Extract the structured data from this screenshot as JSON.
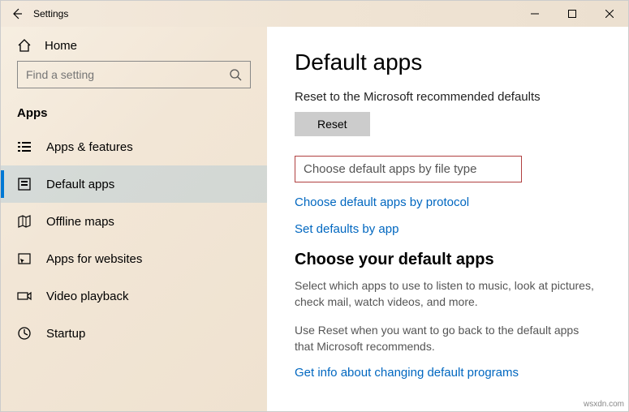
{
  "titlebar": {
    "appname": "Settings"
  },
  "sidebar": {
    "home": "Home",
    "search_placeholder": "Find a setting",
    "category": "Apps",
    "items": [
      {
        "label": "Apps & features"
      },
      {
        "label": "Default apps"
      },
      {
        "label": "Offline maps"
      },
      {
        "label": "Apps for websites"
      },
      {
        "label": "Video playback"
      },
      {
        "label": "Startup"
      }
    ]
  },
  "content": {
    "title": "Default apps",
    "reset_heading": "Reset to the Microsoft recommended defaults",
    "reset_button": "Reset",
    "link_filetype": "Choose default apps by file type",
    "link_protocol": "Choose default apps by protocol",
    "link_byapp": "Set defaults by app",
    "choose_title": "Choose your default apps",
    "desc1": "Select which apps to use to listen to music, look at pictures, check mail, watch videos, and more.",
    "desc2": "Use Reset when you want to go back to the default apps that Microsoft recommends.",
    "info_link": "Get info about changing default programs"
  },
  "watermark": "wsxdn.com"
}
